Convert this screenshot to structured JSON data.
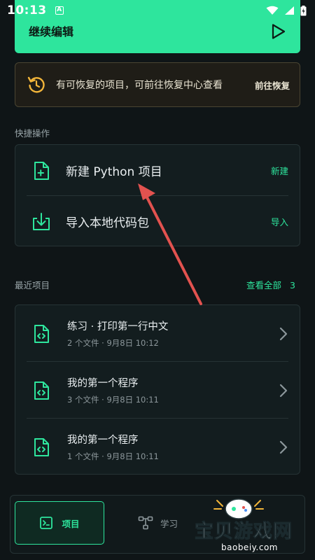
{
  "status_bar": {
    "time": "10:13",
    "a_badge": "A"
  },
  "continue_card": {
    "label": "继续编辑"
  },
  "recover_banner": {
    "message": "有可恢复的项目，可前往恢复中心查看",
    "action": "前往恢复"
  },
  "quick_actions": {
    "title": "快捷操作",
    "items": [
      {
        "label": "新建 Python 项目",
        "action": "新建"
      },
      {
        "label": "导入本地代码包",
        "action": "导入"
      }
    ]
  },
  "recent": {
    "title": "最近项目",
    "view_all": "查看全部",
    "count": "3",
    "projects": [
      {
        "title": "练习 · 打印第一行中文",
        "meta": "2 个文件 · 9月8日 10:12"
      },
      {
        "title": "我的第一个程序",
        "meta": "3 个文件 · 9月8日 10:11"
      },
      {
        "title": "我的第一个程序",
        "meta": "1 个文件 · 9月8日 10:11"
      }
    ]
  },
  "bottom_nav": {
    "items": [
      {
        "label": "项目",
        "active": true
      },
      {
        "label": "学习",
        "active": false
      }
    ]
  },
  "watermark": {
    "text": "宝贝游戏网",
    "url": "baobeiy.com"
  },
  "colors": {
    "accent": "#2ee59d",
    "background": "#0f1517",
    "card": "#131d1f",
    "banner": "#1f1d17",
    "arrow": "#e2524f"
  }
}
